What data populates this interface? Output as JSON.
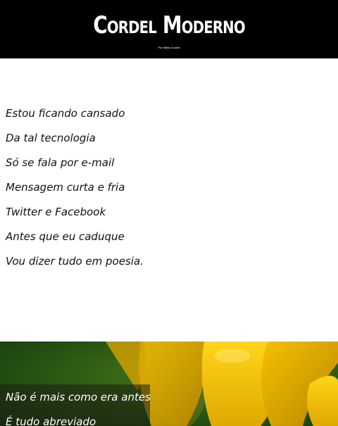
{
  "header": {
    "title": "Cordel Moderno",
    "byline": "Por Milton Duarte"
  },
  "poem": {
    "lines": [
      "Estou ficando cansado",
      "Da tal tecnologia",
      "Só se fala por e-mail",
      "Mensagem curta e fria",
      "Twitter e Facebook",
      "Antes que eu caduque",
      "Vou dizer tudo em poesia."
    ]
  },
  "hero": {
    "lines": [
      "Não é mais como era antes",
      "É tudo abreviado"
    ],
    "colors": {
      "background": "#2b5a13",
      "petal": "#f2c400",
      "petal_dark": "#c99a00"
    }
  }
}
